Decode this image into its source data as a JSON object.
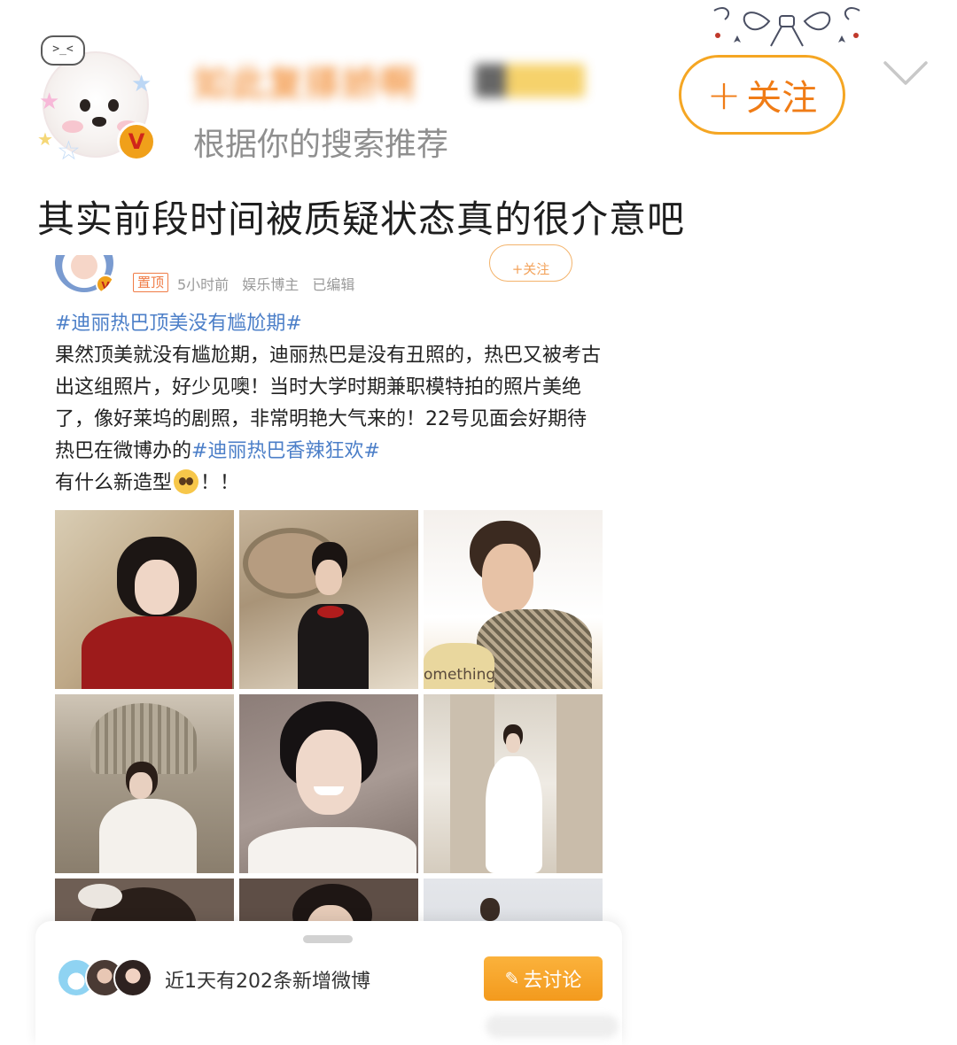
{
  "header": {
    "username": "如此复搽娇啊",
    "subtitle": "根据你的搜索推荐",
    "avatar_bubble": ">_<",
    "follow_label": "关注",
    "follow_icon": "plus-icon",
    "collapse_icon": "chevron-down-icon",
    "verified_mark": "V"
  },
  "headline": "其实前段时间被质疑状态真的很介意吧",
  "card": {
    "pin_label": "置顶",
    "time": "5小时前",
    "source": "娱乐博主",
    "edited": "已编辑",
    "follow_label": "+关注",
    "post": {
      "tag1": "#迪丽热巴顶美没有尴尬期#",
      "text1": "果然顶美就没有尴尬期，迪丽热巴是没有丑照的，热巴又被考古出这组照片，好少见噢！当时大学时期兼职模特拍的照片美绝了，像好莱坞的剧照，非常明艳大气来的！22号见面会好期待热巴在微博办的",
      "tag2": "#迪丽热巴香辣狂欢#",
      "text2": "有什么新造型",
      "emoji_name": "pleading-face-emoji",
      "text3": "！！"
    },
    "photo_caption": "omething",
    "sheet": {
      "new_posts": "近1天有202条新增微博",
      "discuss_label": "去讨论"
    }
  },
  "colors": {
    "accent_orange": "#f07c16",
    "topic_blue": "#4c7fc8",
    "button_orange": "#f5a623"
  }
}
